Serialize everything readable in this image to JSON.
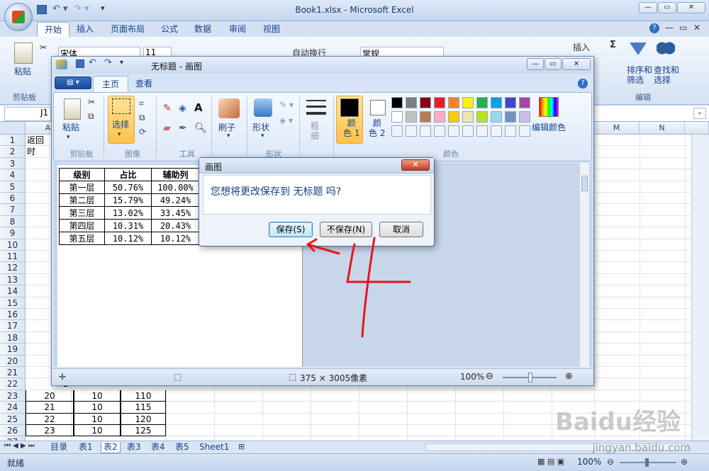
{
  "excel": {
    "title": "Book1.xlsx - Microsoft Excel",
    "tabs": [
      "开始",
      "插入",
      "页面布局",
      "公式",
      "数据",
      "审阅",
      "视图"
    ],
    "ribbon": {
      "paste": "粘贴",
      "clipboard": "剪贴板",
      "font": "宋体",
      "font_size": "11",
      "wrap": "自动换行",
      "number_format": "常规",
      "insert": "插入",
      "sort_filter": "排序和\n筛选",
      "find_select": "查找和\n选择",
      "editing": "编辑",
      "sigma": "Σ"
    },
    "namebox": "J1",
    "columns_visible": [
      "A",
      "M",
      "N"
    ],
    "rows": [
      "1",
      "2",
      "3",
      "4",
      "5",
      "6",
      "7",
      "8",
      "9",
      "10",
      "11",
      "12",
      "13",
      "14",
      "15",
      "16",
      "17",
      "18",
      "19",
      "20",
      "21",
      "22",
      "23",
      "24",
      "25",
      "26",
      "27"
    ],
    "partial_cells": {
      "a1": "返回",
      "a2": "时",
      "a3": "6",
      "a4": "7",
      "a5": "2",
      "a6": "3",
      "a7": "4",
      "a8": "5",
      "a9": "6",
      "a10": "7",
      "a11": "8",
      "a12": "9",
      "a13": "1",
      "a14": "1",
      "a15": "1",
      "a16": "1",
      "a17": "1",
      "a18": "1",
      "a19": "1",
      "a20": "1",
      "a21": "1",
      "a22": "1"
    },
    "table_rows": [
      {
        "row": "23",
        "a": "20",
        "b": "10",
        "c": "110"
      },
      {
        "row": "24",
        "a": "21",
        "b": "10",
        "c": "115"
      },
      {
        "row": "25",
        "a": "22",
        "b": "10",
        "c": "120"
      },
      {
        "row": "26",
        "a": "23",
        "b": "10",
        "c": "125"
      }
    ],
    "sheet_tabs": [
      "目录",
      "表1",
      "表2",
      "表3",
      "表4",
      "表5",
      "Sheet1"
    ],
    "active_sheet": "表2",
    "status": "就绪",
    "zoom": "100%"
  },
  "paint": {
    "title": "无标题 - 画图",
    "tabs": [
      "主页",
      "查看"
    ],
    "groups": {
      "clipboard": "剪贴板",
      "image": "图像",
      "tools": "工具",
      "shapes": "形状",
      "colors": "颜色"
    },
    "buttons": {
      "paste": "粘贴",
      "select": "选择",
      "brush": "刷子",
      "shapes": "形状",
      "size": "粗\n细",
      "color1": "颜\n色 1",
      "color2": "颜\n色 2",
      "edit_colors": "编辑颜色"
    },
    "palette_row1": [
      "#000000",
      "#7f7f7f",
      "#880015",
      "#ed1c24",
      "#ff7f27",
      "#fff200",
      "#22b14c",
      "#00a2e8",
      "#3f48cc",
      "#a349a4"
    ],
    "palette_row2": [
      "#ffffff",
      "#c3c3c3",
      "#b97a57",
      "#ffaec9",
      "#ffc90e",
      "#efe4b0",
      "#b5e61d",
      "#99d9ea",
      "#7092be",
      "#c8bfe7"
    ],
    "canvas_table": {
      "headers": [
        "级别",
        "占比",
        "辅助列"
      ],
      "rows": [
        [
          "第一层",
          "50.76%",
          "100.00%"
        ],
        [
          "第二层",
          "15.79%",
          "49.24%"
        ],
        [
          "第三层",
          "13.02%",
          "33.45%"
        ],
        [
          "第四层",
          "10.31%",
          "20.43%"
        ],
        [
          "第五层",
          "10.12%",
          "10.12%"
        ]
      ]
    },
    "status_size": "375 × 3005像素",
    "zoom": "100%"
  },
  "dialog": {
    "title": "画图",
    "message": "您想将更改保存到 无标题 吗?",
    "save": "保存(S)",
    "dont_save": "不保存(N)",
    "cancel": "取消"
  },
  "annotation": {
    "number": "4",
    "color": "#e8141c"
  },
  "watermark": {
    "logo": "Baidu经验",
    "url": "jingyan.baidu.com"
  }
}
